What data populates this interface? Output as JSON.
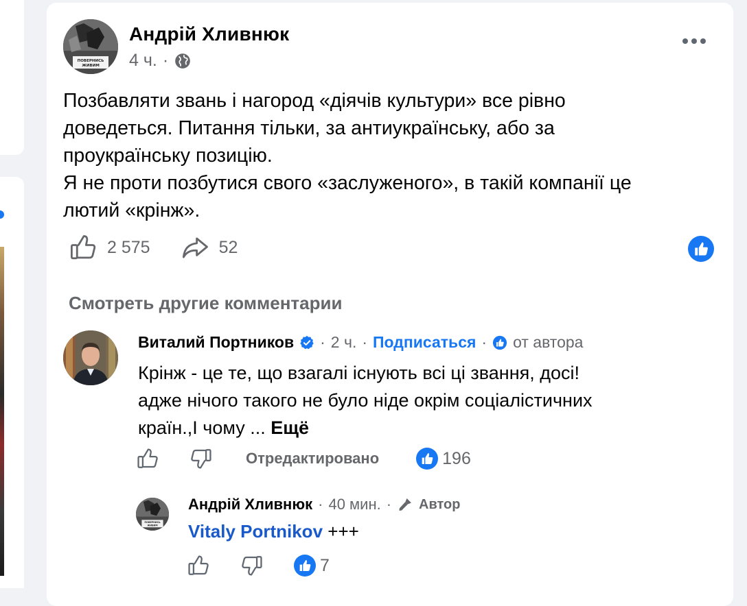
{
  "post": {
    "author": "Андрій Хливнюк",
    "time": "4 ч.",
    "separator": "·",
    "avatar_caption": "ПОВЕРНИСЬ ЖИВИМ",
    "text_lines": [
      "Позбавляти звань і нагород «діячів культури» все рівно",
      "доведеться. Питання тільки, за антиукраїнську, або за",
      "проукраїнську позицію.",
      "Я не проти позбутися свого «заслуженого», в такій компанії це",
      "лютий «крінж»."
    ],
    "likes": "2 575",
    "shares": "52",
    "icons": [
      "globe-icon",
      "more-icon",
      "like-icon",
      "share-icon",
      "like-badge-icon"
    ]
  },
  "comments_link": "Смотреть другие комментарии",
  "comment1": {
    "author": "Виталий Портников",
    "time": "2 ч.",
    "follow": "Подписаться",
    "from_author": "от автора",
    "text_lines": [
      "Крінж - це те, що взагалі існують всі ці звання, досі!",
      "адже нічого такого не було ніде окрім соціалістичних",
      "країн.,І чому ..."
    ],
    "see_more": "Ещё",
    "edited": "Отредактировано",
    "reactions": "196"
  },
  "comment2": {
    "author": "Андрій Хливнюк",
    "time": "40 мин.",
    "badge": "Автор",
    "mention": "Vitaly Portnikov",
    "text": "+++",
    "reactions": "7"
  },
  "colors": {
    "accent": "#1877f2",
    "background": "#f0f2f5",
    "muted": "#65676b"
  }
}
